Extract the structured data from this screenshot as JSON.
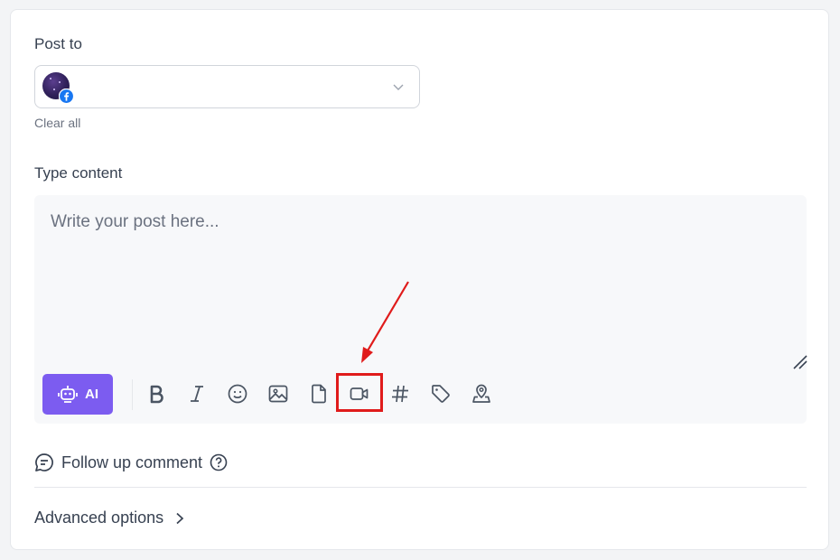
{
  "post_to": {
    "label": "Post to",
    "selected_account_platform": "facebook",
    "clear_all": "Clear all"
  },
  "content": {
    "label": "Type content",
    "placeholder": "Write your post here..."
  },
  "toolbar": {
    "ai_label": "AI",
    "tools": [
      "bold-icon",
      "italic-icon",
      "emoji-icon",
      "image-icon",
      "file-icon",
      "video-icon",
      "hashtag-icon",
      "tag-icon",
      "location-icon"
    ],
    "highlighted_tool": "video-icon"
  },
  "follow_up": {
    "label": "Follow up comment"
  },
  "advanced": {
    "label": "Advanced options"
  },
  "colors": {
    "accent": "#7c5cf0",
    "highlight": "#e01b1b",
    "facebook": "#1877f2"
  }
}
